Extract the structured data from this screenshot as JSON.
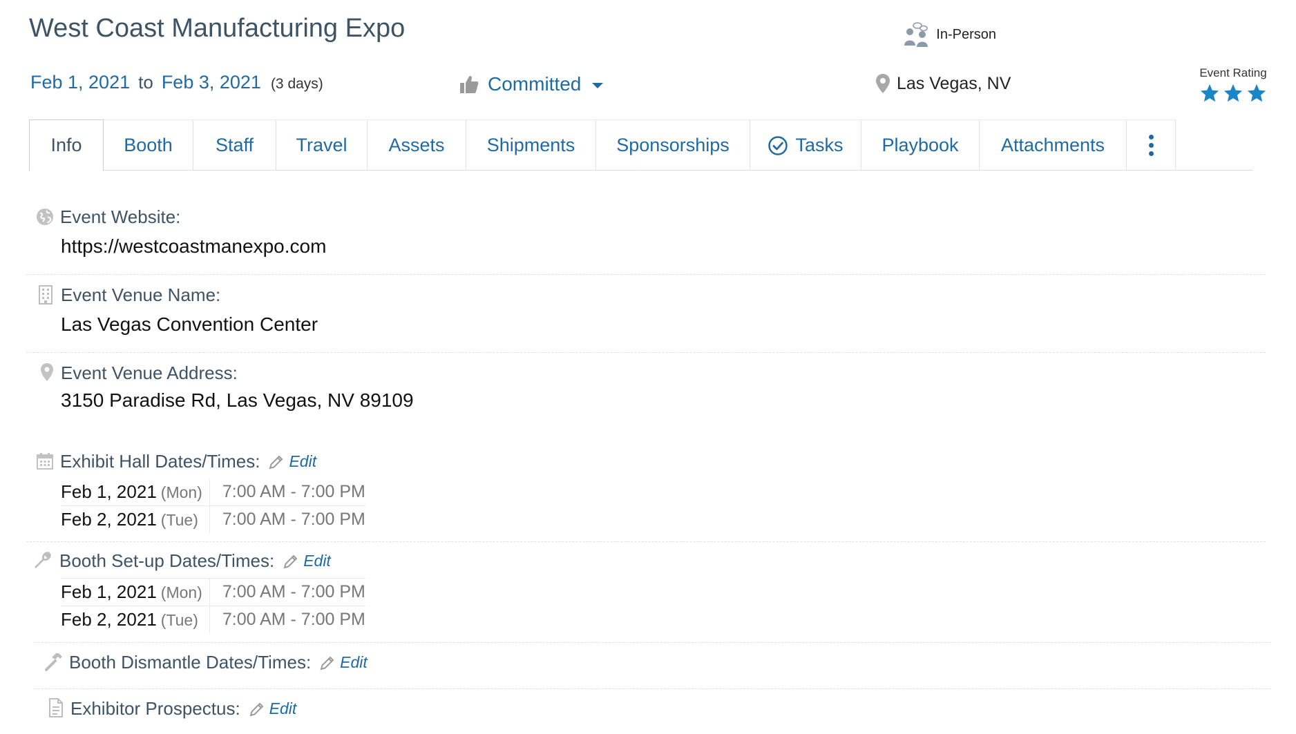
{
  "event": {
    "title": "West Coast Manufacturing Expo",
    "format": "In-Person",
    "start_date": "Feb 1, 2021",
    "to_label": "to",
    "end_date": "Feb 3, 2021",
    "duration": "(3 days)",
    "status": "Committed",
    "location": "Las Vegas, NV",
    "rating_label": "Event Rating",
    "rating": 3,
    "rating_max": 3
  },
  "tabs": [
    {
      "label": "Info",
      "active": true
    },
    {
      "label": "Booth"
    },
    {
      "label": "Staff"
    },
    {
      "label": "Travel"
    },
    {
      "label": "Assets"
    },
    {
      "label": "Shipments"
    },
    {
      "label": "Sponsorships"
    },
    {
      "label": "Tasks",
      "icon": "check-circle-icon"
    },
    {
      "label": "Playbook"
    },
    {
      "label": "Attachments"
    }
  ],
  "info": {
    "website_label": "Event Website:",
    "website_value": "https://westcoastmanexpo.com",
    "venue_name_label": "Event Venue Name:",
    "venue_name_value": "Las Vegas Convention Center",
    "venue_address_label": "Event Venue Address:",
    "venue_address_value": "3150 Paradise Rd, Las Vegas, NV 89109",
    "exhibit_hall_label": "Exhibit Hall Dates/Times:",
    "booth_setup_label": "Booth Set-up Dates/Times:",
    "booth_dismantle_label": "Booth Dismantle Dates/Times:",
    "prospectus_label": "Exhibitor Prospectus:",
    "edit_label": "Edit",
    "exhibit_hall_rows": [
      {
        "date": "Feb 1, 2021",
        "day": "(Mon)",
        "time": "7:00 AM - 7:00 PM"
      },
      {
        "date": "Feb 2, 2021",
        "day": "(Tue)",
        "time": "7:00 AM - 7:00 PM"
      }
    ],
    "booth_setup_rows": [
      {
        "date": "Feb 1, 2021",
        "day": "(Mon)",
        "time": "7:00 AM - 7:00 PM"
      },
      {
        "date": "Feb 2, 2021",
        "day": "(Tue)",
        "time": "7:00 AM - 7:00 PM"
      }
    ]
  },
  "colors": {
    "link": "#1f6aa5",
    "heading": "#3d5366",
    "star": "#1a86c8",
    "icon_gray": "#b8b8b8"
  }
}
